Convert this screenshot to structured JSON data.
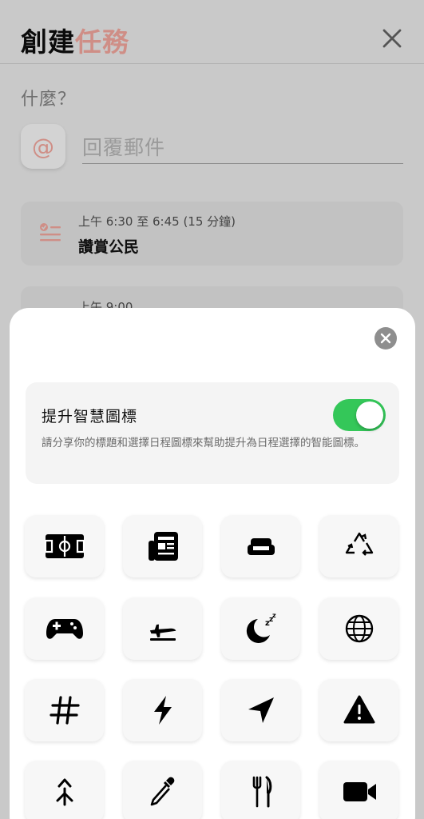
{
  "header": {
    "title_part1": "創建",
    "title_part2": "任務",
    "title_color_accent": "#cf8e86",
    "close_icon": "close-icon"
  },
  "form": {
    "what_label": "什麼？",
    "name_placeholder": "回覆郵件",
    "at_symbol": "@"
  },
  "schedule": [
    {
      "time": "上午 6:30 至 6:45 (15 分鐘)",
      "title": "讚賞公民",
      "icon": "checklist-icon"
    },
    {
      "time": "上午 9:00"
    }
  ],
  "sheet": {
    "close_icon": "close-circle-icon",
    "smart_icons": {
      "title": "提升智慧圖標",
      "description": "請分享你的標題和選擇日程圖標來幫助提升為日程選擇的智能圖標。",
      "enabled": true,
      "toggle_color": "#34c759"
    },
    "icons": [
      "soccer-field-icon",
      "newspaper-icon",
      "sofa-icon",
      "recycle-icon",
      "gamepad-icon",
      "airplane-takeoff-icon",
      "sleep-moon-icon",
      "globe-icon",
      "hashtag-icon",
      "lightning-icon",
      "navigation-arrow-icon",
      "warning-icon",
      "merge-arrow-icon",
      "dropper-icon",
      "fork-knife-icon",
      "video-camera-icon"
    ]
  }
}
